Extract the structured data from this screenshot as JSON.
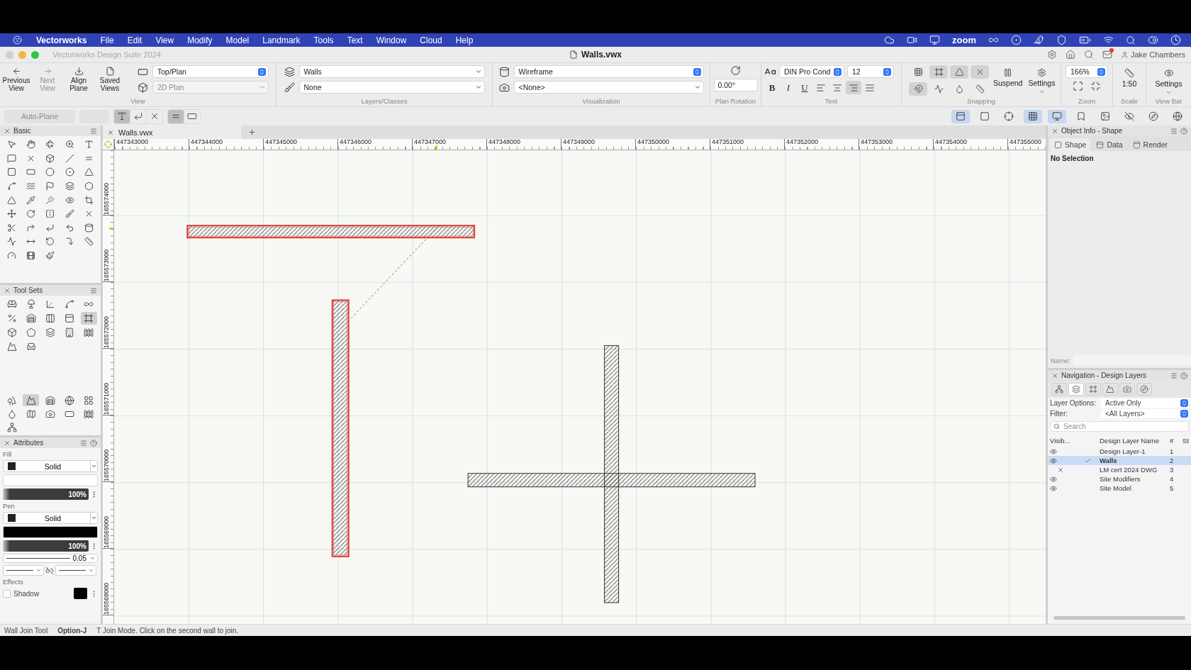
{
  "menu_bar": {
    "app": "Vectorworks",
    "items": [
      "File",
      "Edit",
      "View",
      "Modify",
      "Model",
      "Landmark",
      "Tools",
      "Text",
      "Window",
      "Cloud",
      "Help"
    ],
    "extra_label": "zoom"
  },
  "window": {
    "title": "Vectorworks Design Suite 2024",
    "document": "Walls.vwx",
    "user": "Jake Chambers"
  },
  "view_group": {
    "label": "View",
    "buttons": [
      {
        "label": "Previous View",
        "disabled": false
      },
      {
        "label": "Next View",
        "disabled": true
      },
      {
        "label": "Align Plane",
        "disabled": false
      },
      {
        "label": "Saved Views",
        "disabled": false
      }
    ],
    "projection": "Top/Plan",
    "render": "2D Plan",
    "render_disabled": true
  },
  "layers_group": {
    "label": "Layers/Classes",
    "layer": "Walls",
    "class": "None"
  },
  "visualization_group": {
    "label": "Visualization",
    "render_mode": "Wireframe",
    "viewport": "<None>"
  },
  "rotation_group": {
    "label": "Plan Rotation",
    "value": "0.00°"
  },
  "text_group": {
    "label": "Text",
    "font": "DIN Pro Cond",
    "size": "12",
    "styles": [
      "B",
      "I",
      "U"
    ],
    "alignments": [
      {
        "selected": false
      },
      {
        "selected": false
      },
      {
        "selected": true
      },
      {
        "selected": false
      }
    ]
  },
  "snapping_group": {
    "label": "Snapping",
    "snaps": [
      {
        "on": false
      },
      {
        "on": true
      },
      {
        "on": true
      },
      {
        "on": true
      },
      {
        "on": true
      },
      {
        "on": false
      },
      {
        "on": false
      },
      {
        "on": false
      }
    ],
    "suspend": "Suspend",
    "settings": "Settings"
  },
  "zoom_group": {
    "label": "Zoom",
    "value": "166%"
  },
  "scale_group": {
    "label": "Scale",
    "value": "1:50"
  },
  "view_bar_group": {
    "label": "View Bar",
    "settings": "Settings"
  },
  "mode_bar": {
    "auto_plane": "Auto-Plane",
    "join_modes": [
      {
        "selected": true
      },
      {
        "selected": false
      },
      {
        "selected": false
      }
    ],
    "wall_modes": [
      {
        "selected": true
      },
      {
        "selected": false
      }
    ],
    "view_bar_icons": [
      {
        "on": true
      },
      {
        "on": false
      },
      {
        "on": false
      },
      {
        "on": true
      },
      {
        "on": true
      },
      {
        "on": false
      },
      {
        "on": false
      },
      {
        "on": false
      },
      {
        "on": false
      },
      {
        "on": false
      }
    ]
  },
  "basic_palette": {
    "title": "Basic"
  },
  "tool_sets_palette": {
    "title": "Tool Sets",
    "tools": [
      {
        "selected": false
      },
      {
        "selected": false
      },
      {
        "selected": false
      },
      {
        "selected": false
      },
      {
        "selected": false
      },
      {
        "selected": false
      },
      {
        "selected": false
      },
      {
        "selected": false
      },
      {
        "selected": false
      },
      {
        "selected": true
      },
      {
        "selected": false
      },
      {
        "selected": false
      },
      {
        "selected": false
      },
      {
        "selected": false
      },
      {
        "selected": false
      },
      {
        "selected": false
      },
      {
        "selected": false
      }
    ],
    "sets": [
      {
        "selected": false
      },
      {
        "selected": true
      },
      {
        "selected": false
      },
      {
        "selected": false
      },
      {
        "selected": false
      },
      {
        "selected": false
      },
      {
        "selected": false
      },
      {
        "selected": false
      },
      {
        "selected": false
      },
      {
        "selected": false
      },
      {
        "selected": false
      }
    ]
  },
  "attributes": {
    "title": "Attributes",
    "fill_label": "Fill",
    "fill_style": "Solid",
    "fill_opacity": {
      "value": "100%",
      "level": 1
    },
    "pen_label": "Pen",
    "pen_style": "Solid",
    "pen_opacity": {
      "value": "100%",
      "level": 1
    },
    "line_weight": "0.05",
    "effects_label": "Effects",
    "shadow": {
      "label": "Shadow",
      "checked": false
    }
  },
  "document_tab": {
    "title": "Walls.vwx"
  },
  "rulers": {
    "horizontal": [
      "447343000",
      "447344000",
      "447345000",
      "447346000",
      "447347000",
      "447348000",
      "447349000",
      "447350000",
      "447351000",
      "447352000",
      "447353000",
      "447354000",
      "447355000"
    ],
    "vertical": [
      "165574000",
      "165573000",
      "165572000",
      "165571000",
      "165570000",
      "165569000",
      "165568000"
    ]
  },
  "canvas": {
    "walls": [
      {
        "highlighted": true
      },
      {
        "highlighted": true
      },
      {
        "highlighted": false
      },
      {
        "highlighted": false
      }
    ]
  },
  "object_info": {
    "title": "Object Info - Shape",
    "tabs": [
      {
        "label": "Shape",
        "selected": true
      },
      {
        "label": "Data",
        "selected": false
      },
      {
        "label": "Render",
        "selected": false
      }
    ],
    "message": "No Selection",
    "name_label": "Name:"
  },
  "navigation": {
    "title": "Navigation - Design Layers",
    "tabs": [
      {
        "selected": false
      },
      {
        "selected": true
      },
      {
        "selected": false
      },
      {
        "selected": false
      },
      {
        "selected": false
      },
      {
        "selected": false
      }
    ],
    "layer_options_label": "Layer Options:",
    "layer_options": "Active Only",
    "filter_label": "Filter:",
    "filter": "<All Layers>",
    "search_placeholder": "Search",
    "columns": [
      "Visib...",
      "Design Layer Name",
      "#",
      "St"
    ],
    "layers": [
      {
        "name": "Design Layer-1",
        "number": "1",
        "visible": true,
        "active": false,
        "selected": false
      },
      {
        "name": "Walls",
        "number": "2",
        "visible": true,
        "active": true,
        "selected": true
      },
      {
        "name": "LM cert 2024 DWG",
        "number": "3",
        "visible": false,
        "active": false,
        "selected": false
      },
      {
        "name": "Site Modifiers",
        "number": "4",
        "visible": true,
        "active": false,
        "selected": false
      },
      {
        "name": "Site Model",
        "number": "5",
        "visible": true,
        "active": false,
        "selected": false
      }
    ]
  },
  "status_bar": {
    "tool": "Wall Join Tool",
    "shortcut": "Option-J",
    "hint": "T Join Mode. Click on the second wall to join."
  }
}
